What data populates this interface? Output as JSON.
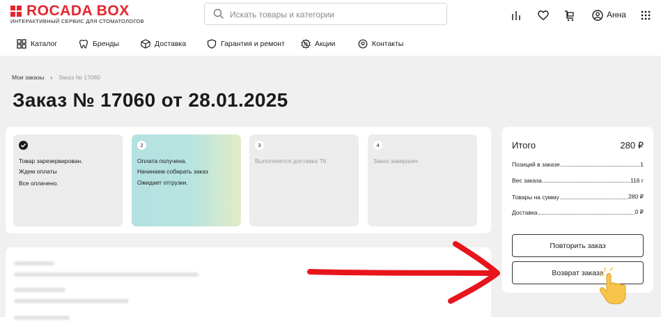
{
  "brand": {
    "name": "ROCADA BOX",
    "tagline": "ИНТЕРАКТИВНЫЙ СЕРВИС ДЛЯ СТОМАТОЛОГОВ",
    "color": "#e3262f"
  },
  "search": {
    "placeholder": "Искать товары и категории",
    "value": ""
  },
  "header_icons": [
    "compare-icon",
    "heart-icon",
    "cart-icon",
    "user-icon",
    "apps-grid-icon"
  ],
  "user": {
    "name": "Анна"
  },
  "nav": [
    {
      "label": "Каталог",
      "icon": "catalog-grid-icon"
    },
    {
      "label": "Бренды",
      "icon": "tooth-icon"
    },
    {
      "label": "Доставка",
      "icon": "box-icon"
    },
    {
      "label": "Гарантия и ремонт",
      "icon": "shield-icon"
    },
    {
      "label": "Акции",
      "icon": "percent-icon"
    },
    {
      "label": "Контакты",
      "icon": "location-pin-icon"
    }
  ],
  "breadcrumb": {
    "parent": "Мои заказы",
    "current": "Заказ № 17060"
  },
  "page_title": "Заказ № 17060 от 28.01.2025",
  "steps": [
    {
      "marker": "check",
      "lines": [
        "Товар зарезервирован.",
        "Ждем оплаты",
        "Все оплачено."
      ],
      "state": "done"
    },
    {
      "marker": "2",
      "lines": [
        "Оплата получена.",
        "Начинаем собирать заказ"
      ],
      "sub": "Ожидает отгрузки.",
      "state": "active"
    },
    {
      "marker": "3",
      "lines": [
        "Выполняется доставка ТК"
      ],
      "state": "pending"
    },
    {
      "marker": "4",
      "lines": [
        "Заказ завершен"
      ],
      "state": "pending"
    }
  ],
  "summary": {
    "title": "Итого",
    "total": "280 ₽",
    "rows": [
      {
        "label": "Позиций в заказе",
        "value": "1"
      },
      {
        "label": "Вес заказа",
        "value": "116 г"
      },
      {
        "label": "Товары на сумму",
        "value": "280 ₽"
      },
      {
        "label": "Доставка",
        "value": "0 ₽"
      }
    ],
    "repeat_button": "Повторить заказ",
    "return_button": "Возврат заказа"
  },
  "annotation": {
    "arrow_color": "#e8141c",
    "pointer": "hand-pointer-icon"
  }
}
